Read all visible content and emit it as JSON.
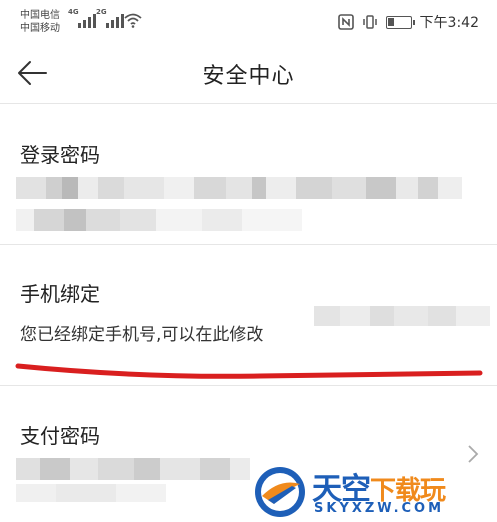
{
  "status_bar": {
    "carrier_1": "中国电信",
    "carrier_2": "中国移动",
    "network_1": "4G",
    "network_2": "2G",
    "time": "下午3:42",
    "icons": [
      "signal-icon",
      "wifi-icon",
      "nfc-icon",
      "vibrate-icon",
      "battery-icon"
    ]
  },
  "header": {
    "title": "安全中心",
    "back_icon": "back-arrow-icon"
  },
  "sections": {
    "login_password": {
      "title": "登录密码"
    },
    "phone_binding": {
      "title": "手机绑定",
      "description": "您已经绑定手机号,可以在此修改"
    },
    "pay_password": {
      "title": "支付密码",
      "chevron_icon": "chevron-right-icon"
    }
  },
  "annotation": {
    "color": "#d91f1f"
  },
  "watermark": {
    "brand_cn_1": "天空",
    "brand_cn_2": "下载玩",
    "brand_en": "SKYXZW.COM"
  },
  "colors": {
    "divider": "#e6e6e6",
    "text": "#222222",
    "blur_light": "#e8e8e8",
    "blur_dark": "#bdbdbd",
    "watermark_blue": "#1e5fb8",
    "watermark_orange": "#f08a1c"
  }
}
